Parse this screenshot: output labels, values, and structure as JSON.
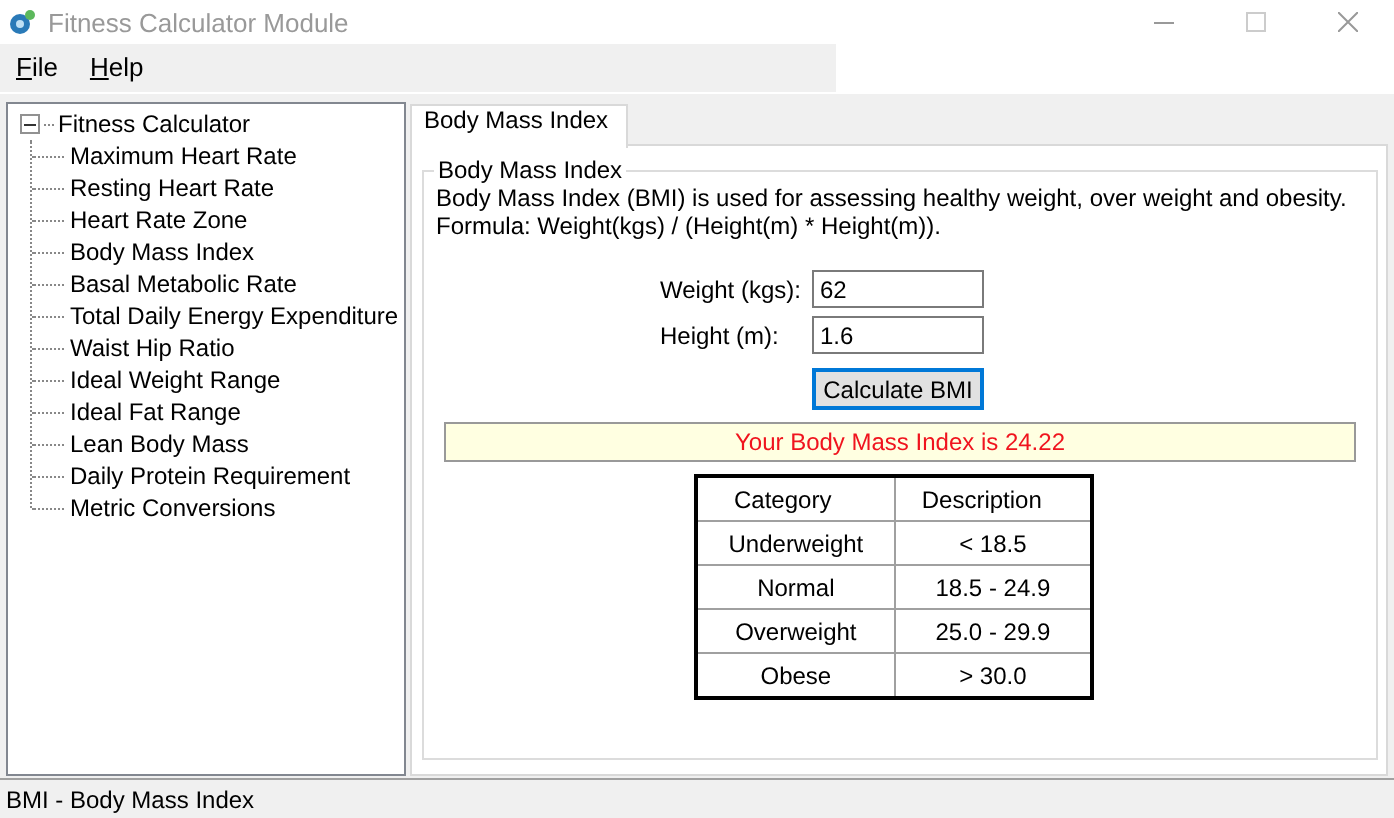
{
  "window": {
    "title": "Fitness Calculator Module"
  },
  "menu": [
    {
      "label": "File"
    },
    {
      "label": "Help"
    }
  ],
  "tree": [
    {
      "label": "Fitness Calculator",
      "expanded": true,
      "children": [
        {
          "label": "Maximum Heart Rate"
        },
        {
          "label": "Resting Heart Rate"
        },
        {
          "label": "Heart Rate Zone"
        },
        {
          "label": "Body Mass Index"
        },
        {
          "label": "Basal Metabolic Rate"
        },
        {
          "label": "Total Daily Energy Expenditure"
        },
        {
          "label": "Waist Hip Ratio"
        },
        {
          "label": "Ideal Weight Range"
        },
        {
          "label": "Ideal Fat Range"
        },
        {
          "label": "Lean Body Mass"
        },
        {
          "label": "Daily Protein Requirement"
        },
        {
          "label": "Metric Conversions"
        }
      ]
    }
  ],
  "tabs": [
    {
      "label": "Body Mass Index",
      "selected": true
    }
  ],
  "group": {
    "title": "Body Mass Index",
    "description": "Body Mass Index (BMI) is used for assessing healthy weight, over weight and obesity.",
    "formula": "Formula: Weight(kgs) / (Height(m) * Height(m))."
  },
  "fields": [
    {
      "label": "Weight (kgs):",
      "value": "62"
    },
    {
      "label": "Height (m):",
      "value": "1.6"
    }
  ],
  "button": "Calculate BMI",
  "result": "Your Body Mass Index is 24.22",
  "table": {
    "columns": [
      "Category",
      "Description"
    ],
    "rows": [
      [
        "Underweight",
        "< 18.5"
      ],
      [
        "Normal",
        "18.5 - 24.9"
      ],
      [
        "Overweight",
        "25.0 - 29.9"
      ],
      [
        "Obese",
        "> 30.0"
      ]
    ]
  },
  "status_bar": "BMI - Body Mass Index"
}
